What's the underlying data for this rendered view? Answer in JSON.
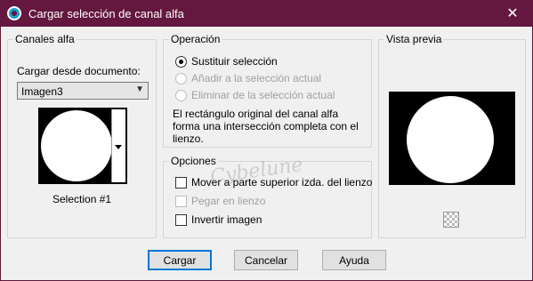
{
  "window": {
    "title": "Cargar selección de canal alfa",
    "close_glyph": "✕",
    "icon": "app-icon"
  },
  "alpha_channels": {
    "legend": "Canales alfa",
    "load_from_label": "Cargar desde documento:",
    "document_selected": "Imagen3",
    "selection_name": "Selection #1"
  },
  "operation": {
    "legend": "Operación",
    "options": [
      {
        "label": "Sustituir selección",
        "selected": true,
        "enabled": true
      },
      {
        "label": "Añadir a la selección actual",
        "selected": false,
        "enabled": false
      },
      {
        "label": "Eliminar de la selección actual",
        "selected": false,
        "enabled": false
      }
    ],
    "description": "El rectángulo original del canal alfa forma una intersección completa con el lienzo."
  },
  "options": {
    "legend": "Opciones",
    "items": [
      {
        "label": "Mover a parte superior izda. del lienzo",
        "checked": false,
        "enabled": true
      },
      {
        "label": "Pegar en lienzo",
        "checked": false,
        "enabled": false
      },
      {
        "label": "Invertir imagen",
        "checked": false,
        "enabled": true
      }
    ]
  },
  "preview": {
    "legend": "Vista previa",
    "toggle_icon": "checkerboard-icon"
  },
  "buttons": {
    "load": "Cargar",
    "cancel": "Cancelar",
    "help": "Ayuda"
  },
  "watermark": "Cybelune",
  "colors": {
    "titlebar": "#64173f",
    "accent": "#0078d7",
    "dialog_bg": "#f0f0f0"
  }
}
